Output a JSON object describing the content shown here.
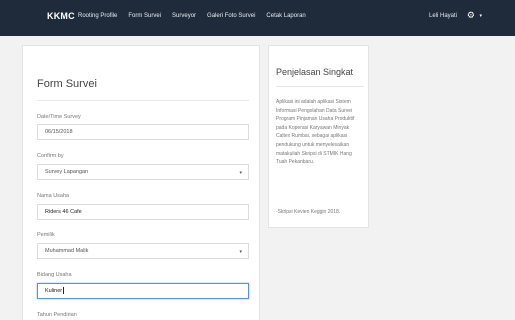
{
  "navbar": {
    "brand": "KKMC",
    "links": [
      "Rooting Profile",
      "Form Survei",
      "Surveyor",
      "Galeri Foto Survei",
      "Cetak Laporan"
    ],
    "user": "Leli Hayati",
    "gear_icon": "gear-icon",
    "caret": "▾"
  },
  "form": {
    "title": "Form Survei",
    "fields": [
      {
        "label": "Date/Time Survey",
        "value": "06/15/2018"
      },
      {
        "label": "Confirm by",
        "value": "Survey Lapangan"
      },
      {
        "label": "Nama Usaha",
        "value": "Riders 46 Cafe"
      },
      {
        "label": "Pemilik",
        "value": "Muhammad Malik"
      },
      {
        "label": "Bidang Usaha",
        "value": "Kuliner"
      },
      {
        "label": "Tahun Pendirian",
        "value": ""
      }
    ]
  },
  "info": {
    "title": "Penjelasan Singkat",
    "body": "Aplikasi ini adalah aplikasi Sistem Informasi Pengolahan Data Survei Program Pinjaman Usaha Produktif pada Koperasi Karyawan Minyak Caltex Rumbai, sebagai aplikasi pendukung untuk menyelesaikan matakuliah Skripsi di STMIK Hang Tuah Pekanbaru.",
    "footer": "-Skripsi Kevien Keggin 2018."
  }
}
